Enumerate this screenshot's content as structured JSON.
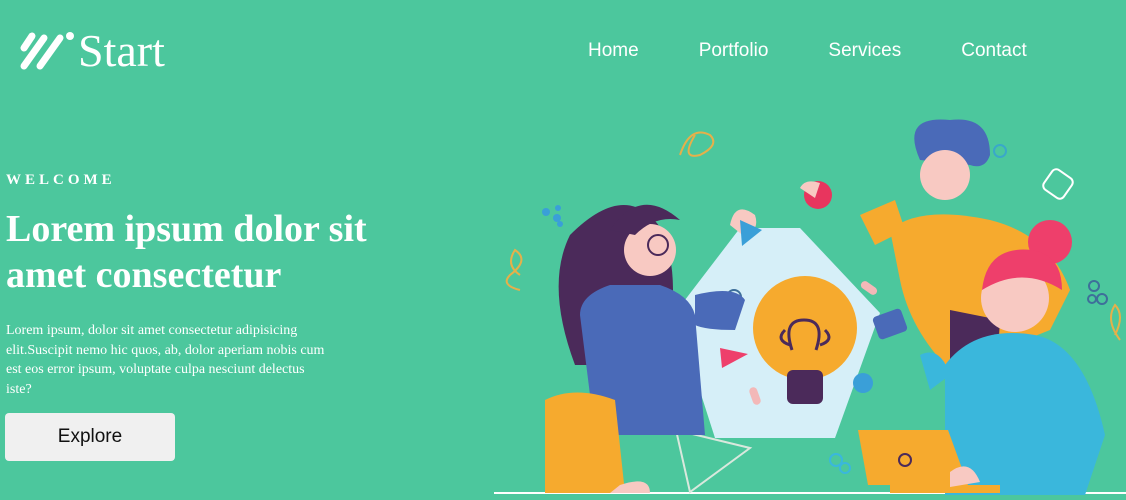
{
  "brand": {
    "name": "Start",
    "logo_icon": "stripes-logo-icon"
  },
  "nav": {
    "items": [
      "Home",
      "Portfolio",
      "Services",
      "Contact"
    ]
  },
  "hero": {
    "eyebrow": "WELCOME",
    "title": "Lorem ipsum dolor sit amet consectetur",
    "description": "Lorem ipsum, dolor sit amet consectetur adipisicing elit.Suscipit nemo hic quos, ab, dolor aperiam nobis cum est eos error ipsum, voluptate culpa nesciunt delectus iste?",
    "cta_label": "Explore"
  },
  "colors": {
    "background": "#4cc79d",
    "text": "#ffffff",
    "button_bg": "#f0f0f0",
    "button_text": "#111111"
  }
}
